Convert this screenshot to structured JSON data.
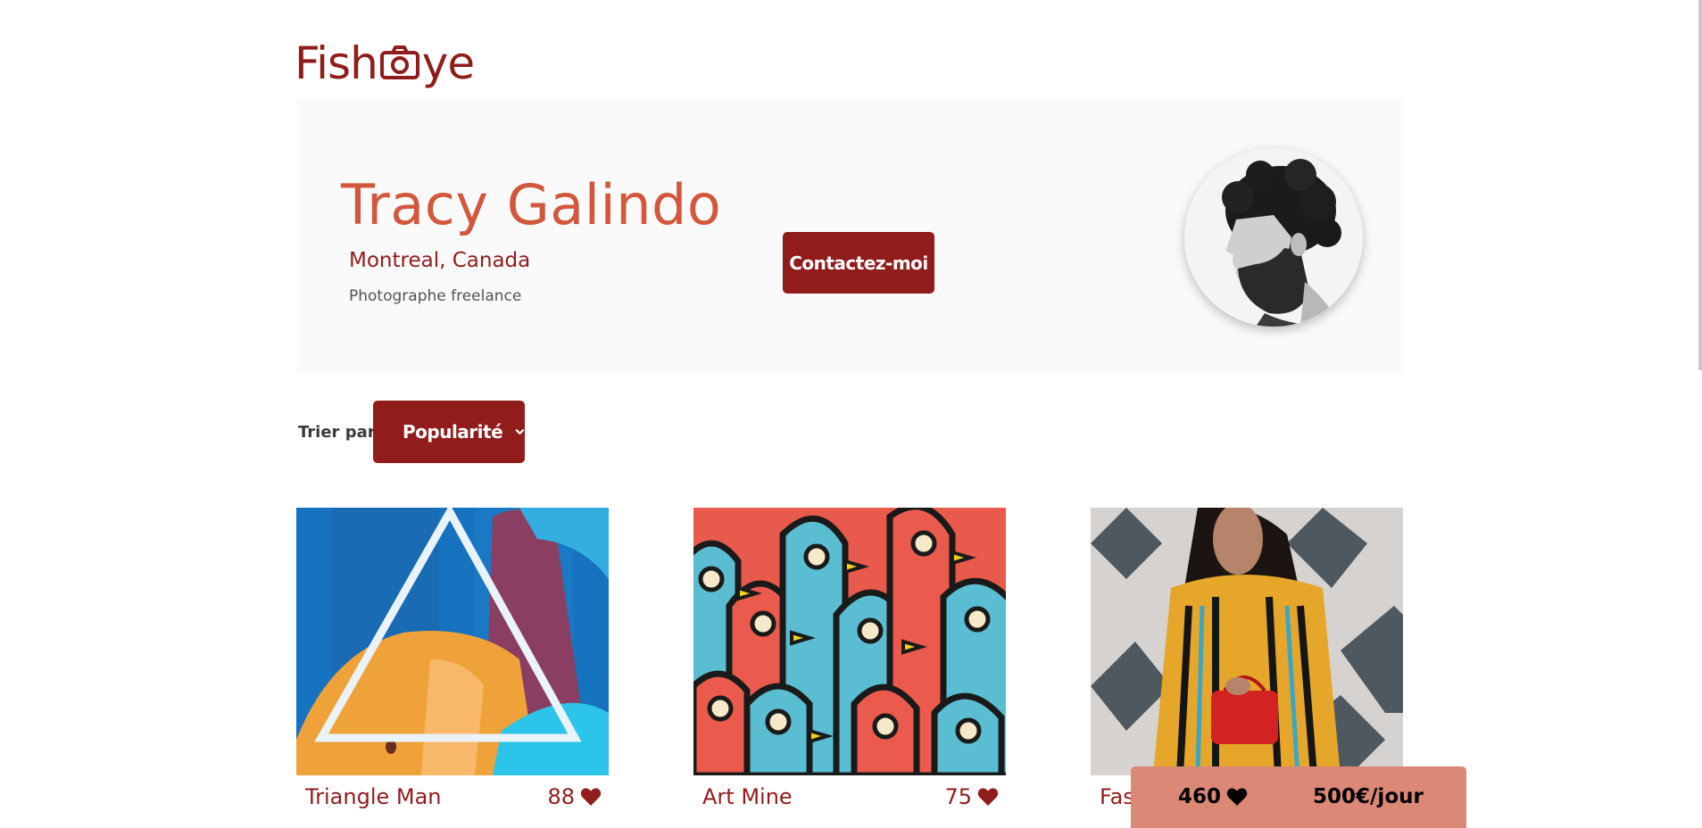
{
  "logo": {
    "text_before": "Fish",
    "text_after": "ye",
    "icon": "camera-icon"
  },
  "photographer": {
    "name": "Tracy Galindo",
    "location": "Montreal, Canada",
    "tagline": "Photographe freelance",
    "avatar_icon": "portrait-photo"
  },
  "contact_button": {
    "label": "Contactez-moi"
  },
  "sort": {
    "label": "Trier par",
    "selected": "Popularité",
    "icon": "chevron-down-icon"
  },
  "gallery": [
    {
      "title": "Triangle Man",
      "likes": "88"
    },
    {
      "title": "Art Mine",
      "likes": "75"
    },
    {
      "title": "Fas",
      "likes": ""
    }
  ],
  "sticky": {
    "total_likes": "460",
    "price": "500€/jour"
  },
  "colors": {
    "brand": "#901c1c",
    "accent": "#d3573c",
    "sticky_bg": "#db8876",
    "banner_bg": "#fafafa"
  }
}
